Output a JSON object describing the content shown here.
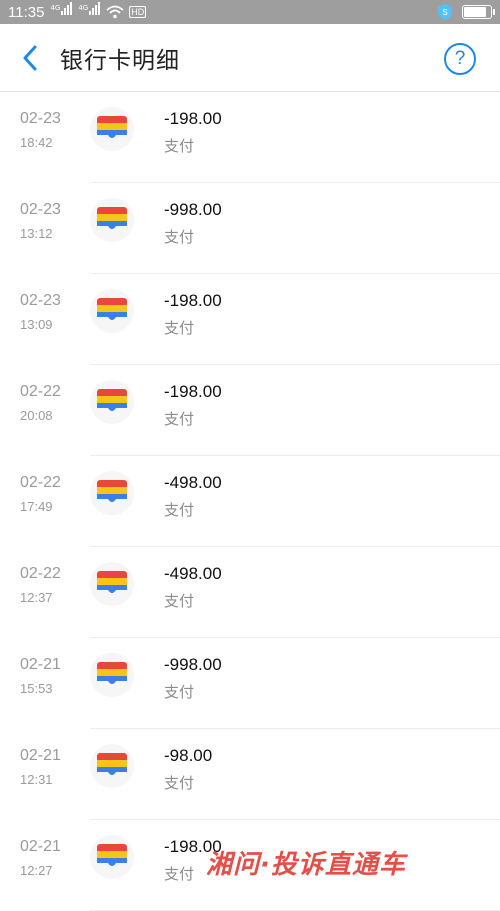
{
  "status_bar": {
    "time": "11:35",
    "net_tag_1": "4G",
    "net_tag_2": "4G",
    "hd_tag": "HD",
    "battery_level": 0.85
  },
  "header": {
    "title": "银行卡明细",
    "help_label": "?"
  },
  "transactions": [
    {
      "date": "02-23",
      "time": "18:42",
      "amount": "-198.00",
      "type": "支付"
    },
    {
      "date": "02-23",
      "time": "13:12",
      "amount": "-998.00",
      "type": "支付"
    },
    {
      "date": "02-23",
      "time": "13:09",
      "amount": "-198.00",
      "type": "支付"
    },
    {
      "date": "02-22",
      "time": "20:08",
      "amount": "-198.00",
      "type": "支付"
    },
    {
      "date": "02-22",
      "time": "17:49",
      "amount": "-498.00",
      "type": "支付"
    },
    {
      "date": "02-22",
      "time": "12:37",
      "amount": "-498.00",
      "type": "支付"
    },
    {
      "date": "02-21",
      "time": "15:53",
      "amount": "-998.00",
      "type": "支付"
    },
    {
      "date": "02-21",
      "time": "12:31",
      "amount": "-98.00",
      "type": "支付"
    },
    {
      "date": "02-21",
      "time": "12:27",
      "amount": "-198.00",
      "type": "支付"
    }
  ],
  "watermark": "湘问·投诉直通车",
  "colors": {
    "accent": "#1e88e5",
    "card_red": "#e8483b",
    "card_yellow": "#f5c518",
    "card_blue": "#3b7fe8"
  }
}
